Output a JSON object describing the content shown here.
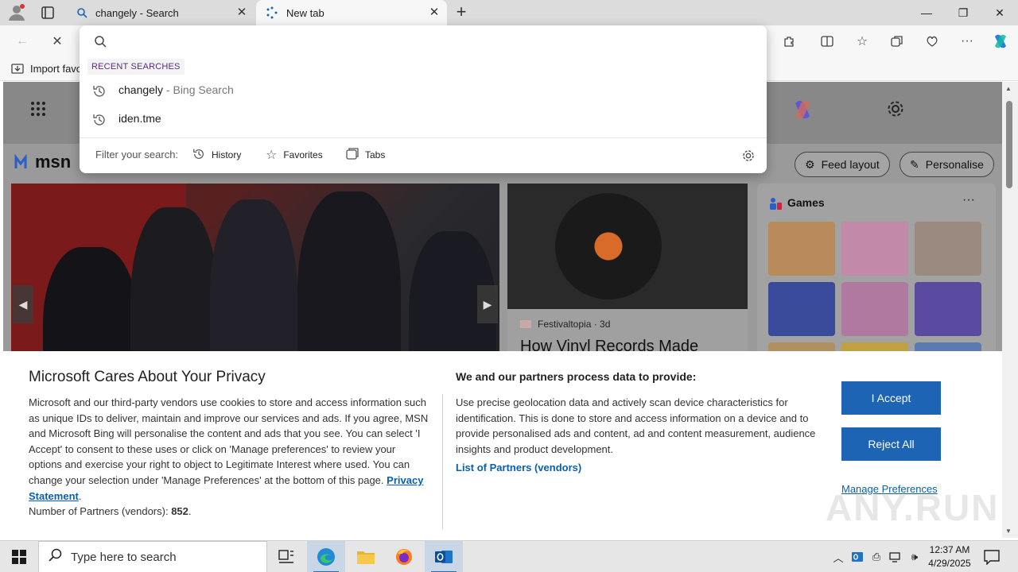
{
  "browser": {
    "tabs": [
      {
        "title": "changely - Search",
        "icon": "search-icon"
      },
      {
        "title": "New tab",
        "icon": "newtab-icon"
      }
    ],
    "favorites_bar": {
      "import_label": "Import favo"
    }
  },
  "omnibox": {
    "input_value": "",
    "recent_header": "RECENT SEARCHES",
    "suggestions": [
      {
        "text": "changely",
        "sub": " - Bing Search"
      },
      {
        "text": "iden.tme",
        "sub": ""
      }
    ],
    "filter_label": "Filter your search:",
    "filters": [
      "History",
      "Favorites",
      "Tabs"
    ]
  },
  "msn": {
    "logo": "msn",
    "feed_layout_label": "Feed layout",
    "personalise_label": "Personalise",
    "card": {
      "source": "Festivaltopia",
      "age": " · 3d",
      "headline": "How Vinyl Records Made"
    },
    "games_title": "Games",
    "games_more": "···"
  },
  "privacy": {
    "title": "Microsoft Cares About Your Privacy",
    "body": "Microsoft and our third-party vendors use cookies to store and access information such as unique IDs to deliver, maintain and improve our services and ads. If you agree, MSN and Microsoft Bing will personalise the content and ads that you see. You can select 'I Accept' to consent to these uses or click on 'Manage preferences' to review your options and exercise your right to object to Legitimate Interest where used.  You can change your selection under 'Manage Preferences' at the bottom of this page.",
    "privacy_link": "Privacy Statement",
    "partners_label": "Number of Partners (vendors): ",
    "partners_count": "852",
    "right_title": "We and our partners process data to provide:",
    "right_body": "Use precise geolocation data and actively scan device characteristics for identification. This is done to store and access information on a device and to provide personalised ads and content, ad and content measurement, audience insights and product development.",
    "partners_link": "List of Partners (vendors)",
    "accept": "I Accept",
    "reject": "Reject All",
    "manage": "Manage Preferences"
  },
  "watermark": "ANY.RUN",
  "taskbar": {
    "search_placeholder": "Type here to search",
    "time": "12:37 AM",
    "date": "4/29/2025"
  },
  "colors": {
    "accent": "#1e64b4",
    "link": "#0a5fb0",
    "recent": "#5b2d7a"
  }
}
